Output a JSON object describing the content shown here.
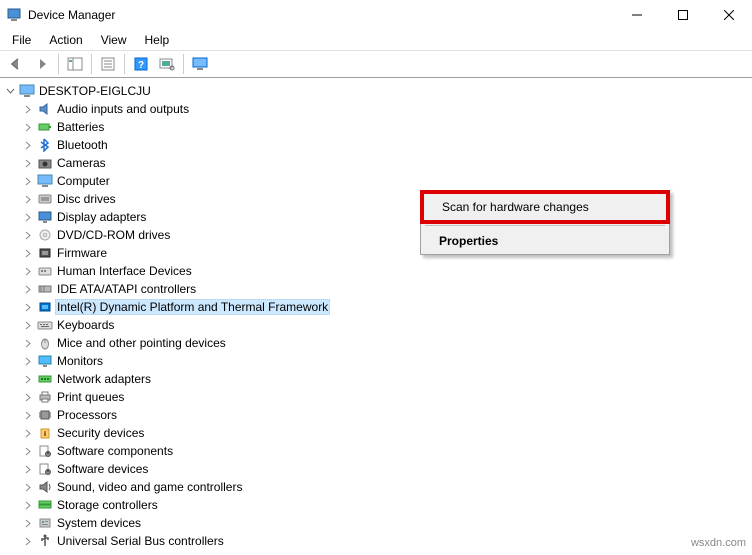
{
  "titlebar": {
    "title": "Device Manager"
  },
  "menubar": {
    "items": [
      "File",
      "Action",
      "View",
      "Help"
    ]
  },
  "tree": {
    "root": {
      "label": "DESKTOP-EIGLCJU",
      "expanded": true
    },
    "children": [
      {
        "label": "Audio inputs and outputs",
        "icon": "audio"
      },
      {
        "label": "Batteries",
        "icon": "battery"
      },
      {
        "label": "Bluetooth",
        "icon": "bluetooth"
      },
      {
        "label": "Cameras",
        "icon": "camera"
      },
      {
        "label": "Computer",
        "icon": "computer"
      },
      {
        "label": "Disc drives",
        "icon": "disc"
      },
      {
        "label": "Display adapters",
        "icon": "display"
      },
      {
        "label": "DVD/CD-ROM drives",
        "icon": "dvd"
      },
      {
        "label": "Firmware",
        "icon": "firmware"
      },
      {
        "label": "Human Interface Devices",
        "icon": "hid"
      },
      {
        "label": "IDE ATA/ATAPI controllers",
        "icon": "ide"
      },
      {
        "label": "Intel(R) Dynamic Platform and Thermal Framework",
        "icon": "intel",
        "selected": true
      },
      {
        "label": "Keyboards",
        "icon": "keyboard"
      },
      {
        "label": "Mice and other pointing devices",
        "icon": "mouse"
      },
      {
        "label": "Monitors",
        "icon": "monitor"
      },
      {
        "label": "Network adapters",
        "icon": "network"
      },
      {
        "label": "Print queues",
        "icon": "print"
      },
      {
        "label": "Processors",
        "icon": "processor"
      },
      {
        "label": "Security devices",
        "icon": "security"
      },
      {
        "label": "Software components",
        "icon": "software"
      },
      {
        "label": "Software devices",
        "icon": "software"
      },
      {
        "label": "Sound, video and game controllers",
        "icon": "sound"
      },
      {
        "label": "Storage controllers",
        "icon": "storage"
      },
      {
        "label": "System devices",
        "icon": "system"
      },
      {
        "label": "Universal Serial Bus controllers",
        "icon": "usb"
      }
    ]
  },
  "context_menu": {
    "items": [
      {
        "label": "Scan for hardware changes",
        "highlighted": true
      },
      {
        "label": "Properties",
        "bold": true
      }
    ]
  },
  "watermark": "wsxdn.com"
}
